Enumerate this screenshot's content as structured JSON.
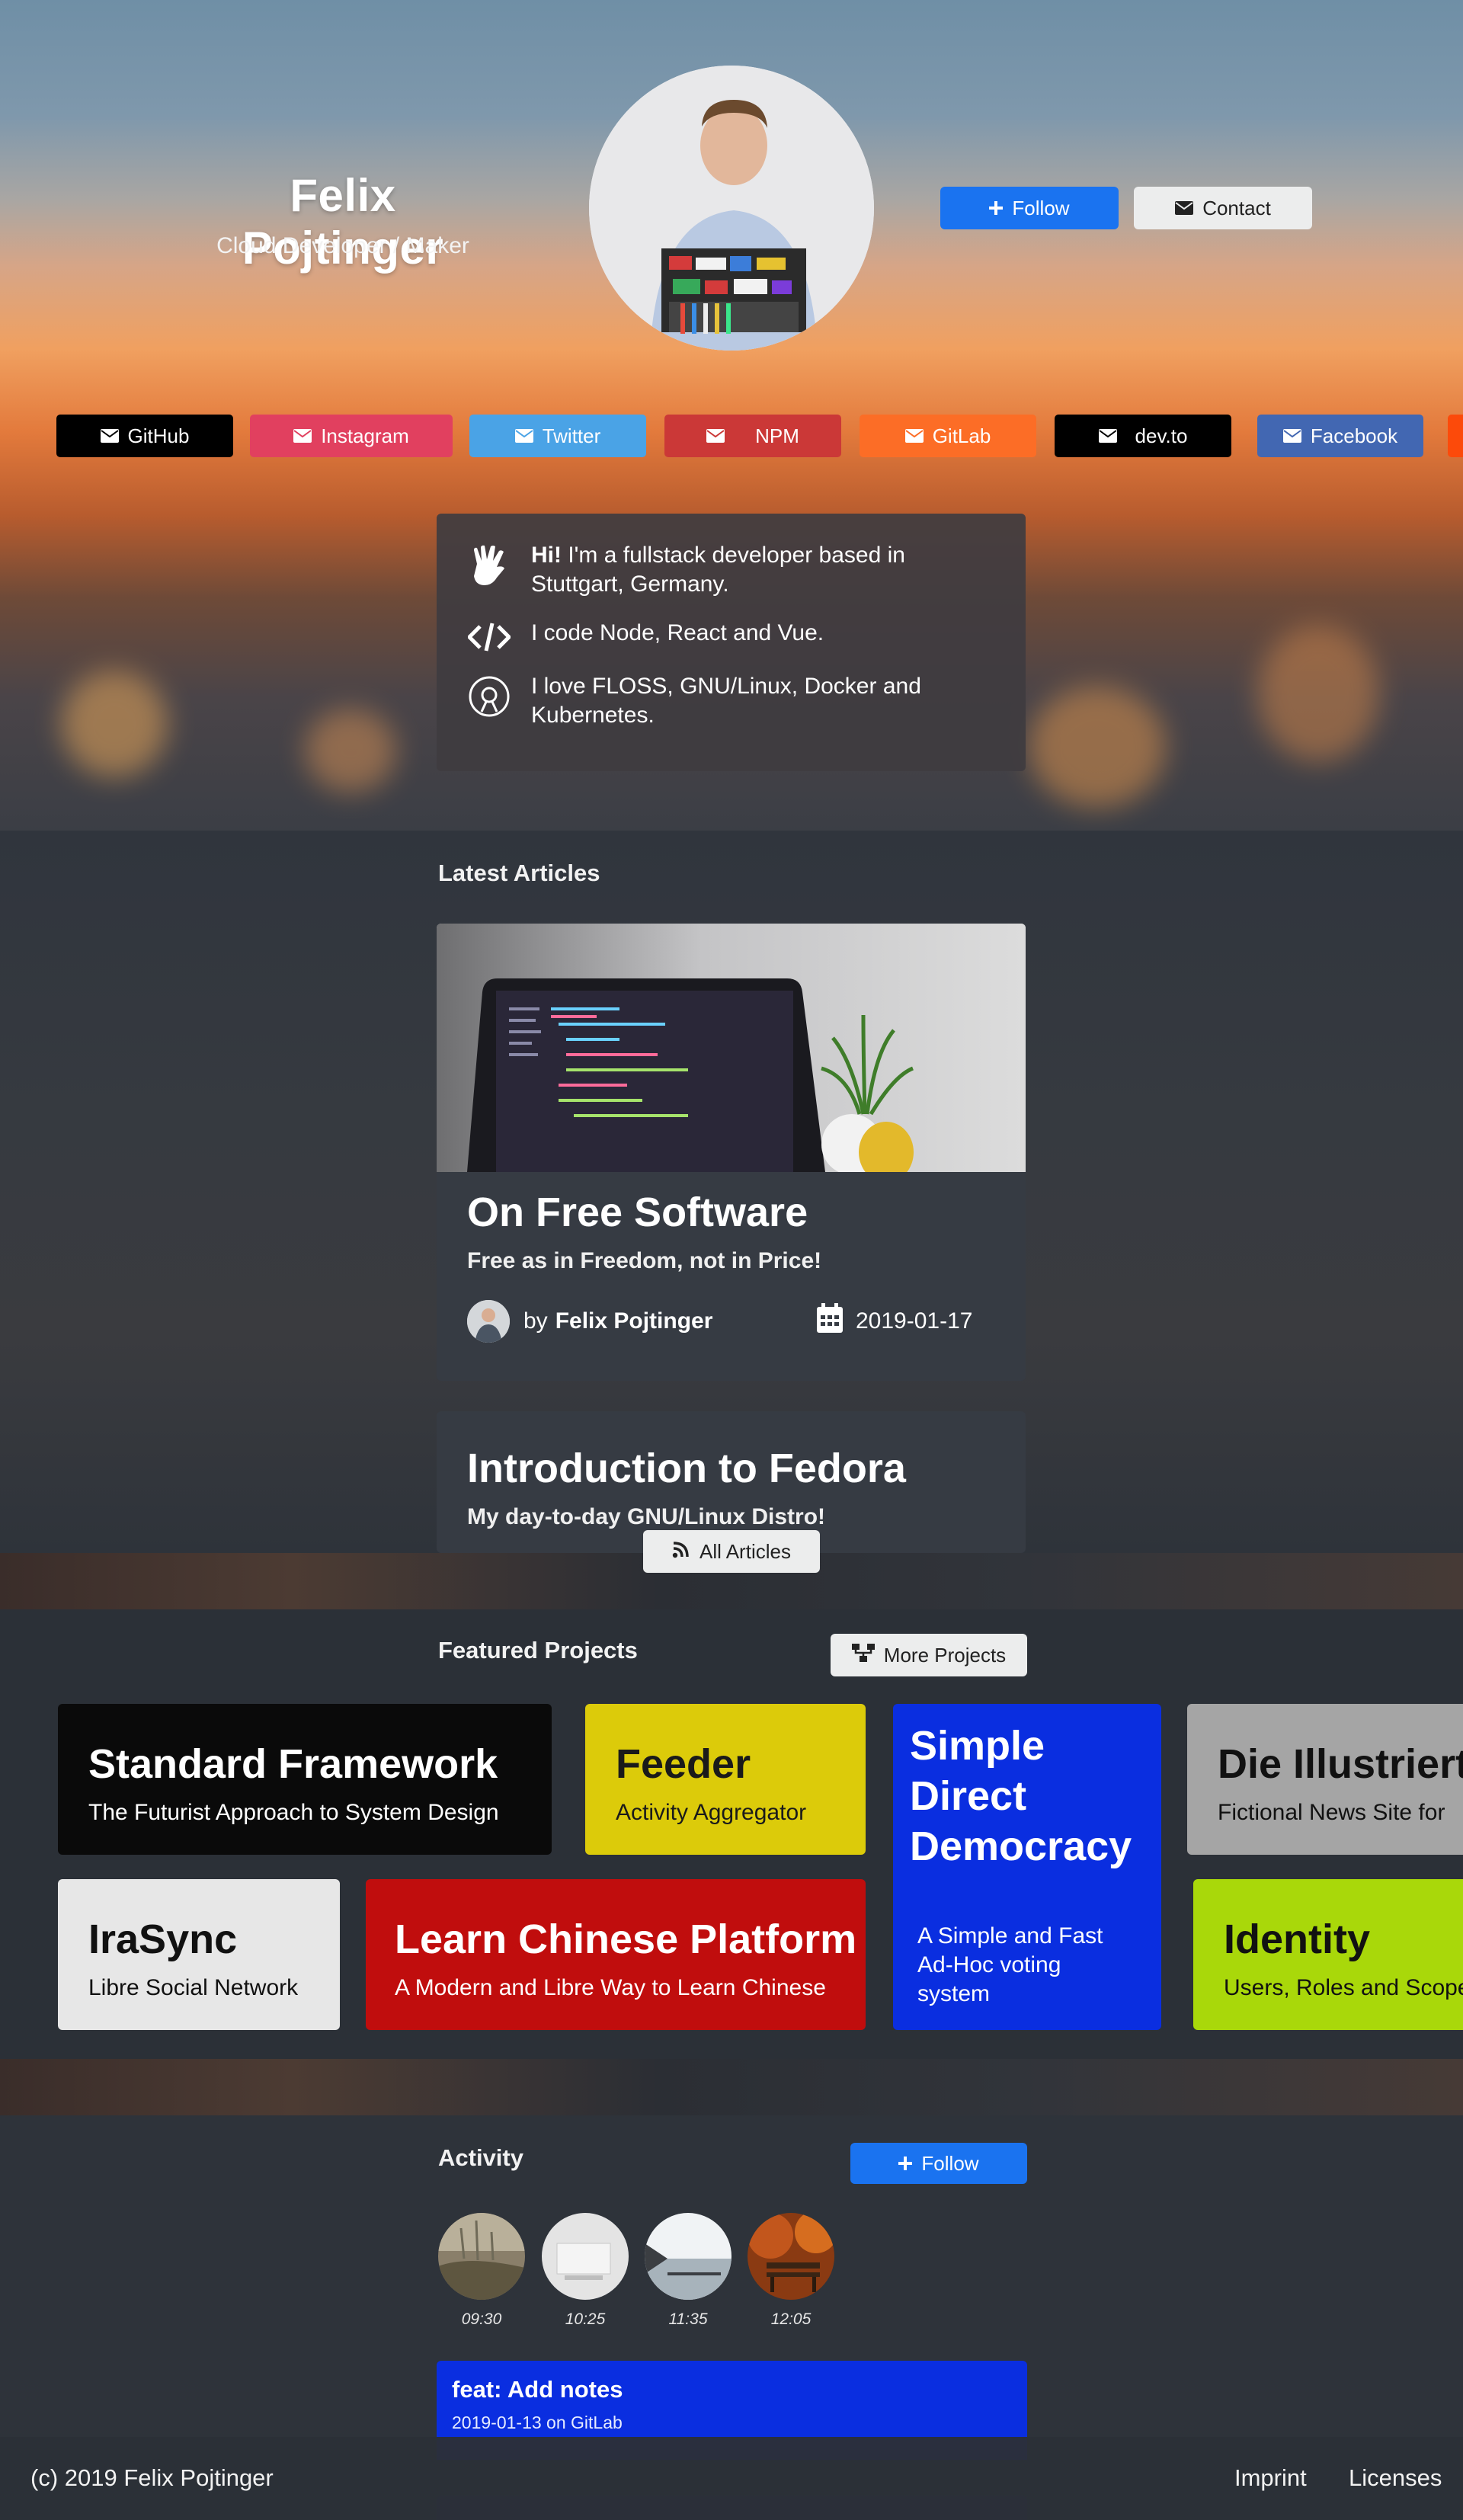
{
  "profile": {
    "name": "Felix Pojtinger",
    "role": "Cloud Developer / Maker",
    "follow_label": "Follow",
    "contact_label": "Contact"
  },
  "social": [
    {
      "label": "GitHub",
      "color": "#000000"
    },
    {
      "label": "Instagram",
      "color": "#e1405f"
    },
    {
      "label": "Twitter",
      "color": "#4aa3e6"
    },
    {
      "label": "NPM",
      "color": "#cb3837"
    },
    {
      "label": "GitLab",
      "color": "#fc6d26"
    },
    {
      "label": "dev.to",
      "color": "#000000"
    },
    {
      "label": "Facebook",
      "color": "#4267b2"
    }
  ],
  "about": {
    "hi": "Hi!",
    "line1": " I'm a fullstack developer based in Stuttgart, Germany.",
    "line2": "I code Node, React and Vue.",
    "line3": "I love FLOSS, GNU/Linux, Docker and Kubernetes."
  },
  "articles": {
    "section_title": "Latest Articles",
    "items": [
      {
        "title": "On Free Software",
        "subtitle": "Free as in Freedom, not in Price!",
        "by": "by",
        "author": "Felix Pojtinger",
        "date": "2019-01-17"
      },
      {
        "title": "Introduction to Fedora",
        "subtitle": "My day-to-day GNU/Linux Distro!"
      }
    ],
    "all_label": "All Articles"
  },
  "projects": {
    "section_title": "Featured Projects",
    "more_label": "More Projects",
    "items": [
      {
        "title": "Standard Framework",
        "subtitle": "The Futurist Approach to System Design",
        "bg": "#0a0a0a",
        "fg": "#ffffff"
      },
      {
        "title": "Feeder",
        "subtitle": "Activity Aggregator",
        "bg": "#dccb0a",
        "fg": "#1a1a1a"
      },
      {
        "title": "Simple Direct Democracy",
        "subtitle": "A Simple and Fast Ad-Hoc voting system",
        "bg": "#0a2ee0",
        "fg": "#ffffff"
      },
      {
        "title": "Die Illustrierte",
        "subtitle": "Fictional News Site for",
        "bg": "#a5a5a5",
        "fg": "#111111"
      },
      {
        "title": "IraSync",
        "subtitle": "Libre Social Network",
        "bg": "#e7e7e7",
        "fg": "#111111"
      },
      {
        "title": "Learn Chinese Platform",
        "subtitle": "A Modern and Libre Way to Learn Chinese",
        "bg": "#c00d0d",
        "fg": "#ffffff"
      },
      {
        "title": "Identity",
        "subtitle": "Users, Roles and Scope",
        "bg": "#a9d80a",
        "fg": "#111111"
      }
    ]
  },
  "activity": {
    "section_title": "Activity",
    "follow_label": "Follow",
    "times": [
      "09:30",
      "10:25",
      "11:35",
      "12:05"
    ],
    "latest": {
      "title": "feat: Add notes",
      "meta": "2019-01-13 on GitLab"
    }
  },
  "footer": {
    "copyright": "(c) 2019 Felix Pojtinger",
    "imprint": "Imprint",
    "licenses": "Licenses"
  },
  "colors": {
    "accent_blue": "#1a73f0",
    "card_bg": "#363b43",
    "about_bg": "#3f3c40"
  }
}
